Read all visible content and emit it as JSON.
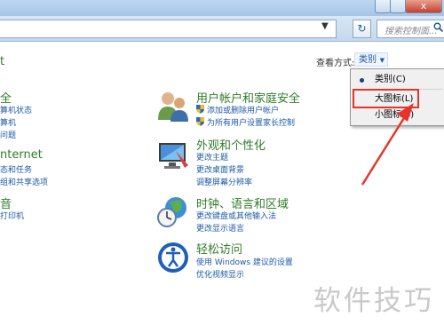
{
  "titlebar": {
    "close_glyph": "x"
  },
  "address": {
    "refresh_glyph": "↻",
    "dropdown_glyph": "▼"
  },
  "search": {
    "placeholder": "搜索控制面...",
    "icon": "search-icon"
  },
  "view": {
    "label": "查看方式:",
    "value": "类别",
    "dropdown_glyph": "▼",
    "menu": [
      {
        "label": "类别(C)",
        "selected": true
      },
      {
        "label": "大图标(L)",
        "selected": false,
        "highlighted": true
      },
      {
        "label": "小图标(S)",
        "selected": false
      }
    ]
  },
  "left_partial": {
    "heading_fragment": "t",
    "groups": [
      {
        "title": "全",
        "links": [
          "算机状态",
          "算机",
          "问题"
        ]
      },
      {
        "title": "nternet",
        "links": [
          "态和任务",
          "组和共享选项"
        ]
      },
      {
        "title": "音",
        "links": [
          "打印机"
        ]
      }
    ]
  },
  "categories": [
    {
      "title": "用户帐户和家庭安全",
      "icon": "users-icon",
      "links": [
        "添加或删除用户帐户",
        "为所有用户设置家长控制"
      ]
    },
    {
      "title": "外观和个性化",
      "icon": "display-icon",
      "links": [
        "更改主题",
        "更改桌面背景",
        "调整屏幕分辨率"
      ]
    },
    {
      "title": "时钟、语言和区域",
      "icon": "globe-clock-icon",
      "links": [
        "更改键盘或其他输入法",
        "更改显示语言"
      ]
    },
    {
      "title": "轻松访问",
      "icon": "accessibility-icon",
      "links": [
        "使用 Windows 建议的设置",
        "优化视频显示"
      ]
    }
  ],
  "watermark": "软件技巧",
  "colors": {
    "accent": "#1e5aa8",
    "category_title": "#2f7d2a",
    "annotation": "#e8332a"
  }
}
